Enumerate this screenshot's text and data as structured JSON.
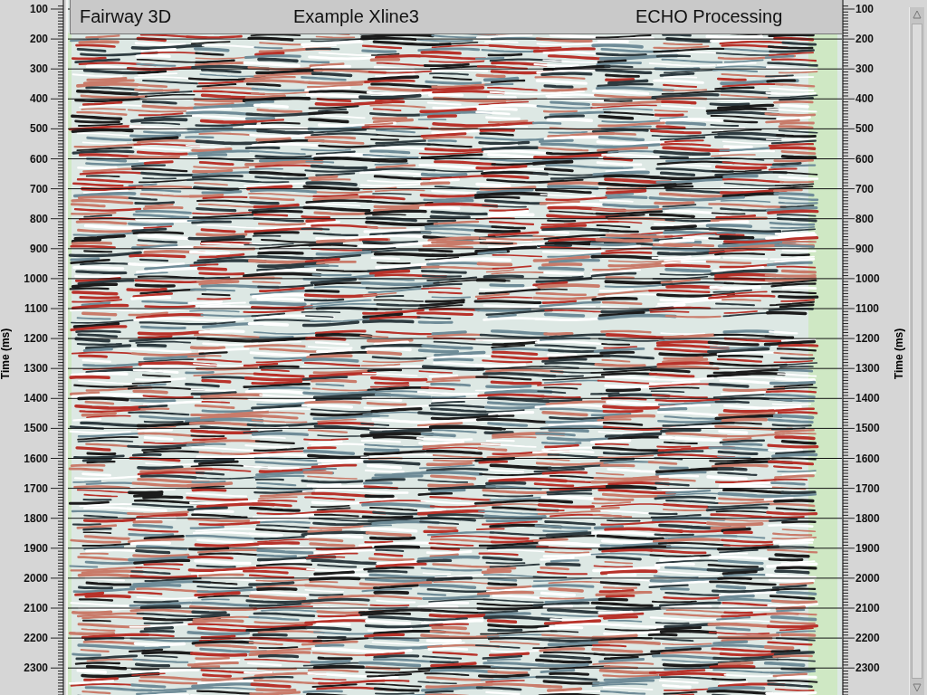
{
  "title_bar": {
    "texts": [
      "Fairway 3D",
      "Example Xline3",
      "ECHO Processing"
    ]
  },
  "left_axis": {
    "label": "Time (ms)",
    "ticks": [
      "100",
      "200",
      "300",
      "400",
      "500",
      "600",
      "700",
      "800",
      "900",
      "1000",
      "1100",
      "1200",
      "1300",
      "1400",
      "1500",
      "1600",
      "1700",
      "1800",
      "1900",
      "2000",
      "2100",
      "2200",
      "2300"
    ]
  },
  "right_axis": {
    "label": "Time (ms)",
    "ticks": [
      "100",
      "200",
      "300",
      "400",
      "500",
      "600",
      "700",
      "800",
      "900",
      "1000",
      "1100",
      "1200",
      "1300",
      "1400",
      "1500",
      "1600",
      "1700",
      "1800",
      "1900",
      "2000",
      "2100",
      "2200",
      "2300"
    ]
  }
}
